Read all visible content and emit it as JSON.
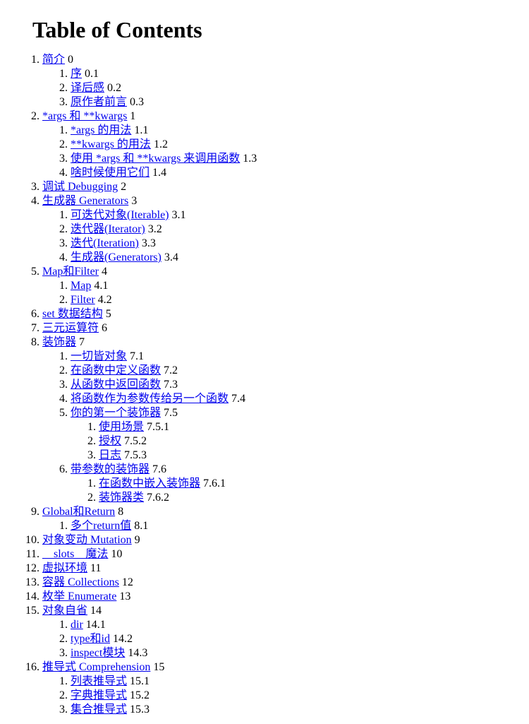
{
  "title": "Table of Contents",
  "toc": [
    {
      "label": "简介",
      "num": "0",
      "children": [
        {
          "label": "序",
          "num": "0.1"
        },
        {
          "label": "译后感",
          "num": "0.2"
        },
        {
          "label": "原作者前言",
          "num": "0.3"
        }
      ]
    },
    {
      "label": "*args 和 **kwargs",
      "num": "1",
      "children": [
        {
          "label": "*args 的用法",
          "num": "1.1"
        },
        {
          "label": "**kwargs 的用法",
          "num": "1.2"
        },
        {
          "label": "使用 *args 和 **kwargs 来调用函数",
          "num": "1.3"
        },
        {
          "label": "啥时候使用它们",
          "num": "1.4"
        }
      ]
    },
    {
      "label": "调试 Debugging",
      "num": "2"
    },
    {
      "label": "生成器 Generators",
      "num": "3",
      "children": [
        {
          "label": "可迭代对象(Iterable)",
          "num": "3.1"
        },
        {
          "label": "迭代器(Iterator)",
          "num": "3.2"
        },
        {
          "label": "迭代(Iteration)",
          "num": "3.3"
        },
        {
          "label": "生成器(Generators)",
          "num": "3.4"
        }
      ]
    },
    {
      "label": "Map和Filter",
      "num": "4",
      "children": [
        {
          "label": "Map",
          "num": "4.1"
        },
        {
          "label": "Filter",
          "num": "4.2"
        }
      ]
    },
    {
      "label": "set 数据结构",
      "num": "5"
    },
    {
      "label": "三元运算符",
      "num": "6"
    },
    {
      "label": "装饰器",
      "num": "7",
      "children": [
        {
          "label": "一切皆对象",
          "num": "7.1"
        },
        {
          "label": "在函数中定义函数",
          "num": "7.2"
        },
        {
          "label": "从函数中返回函数",
          "num": "7.3"
        },
        {
          "label": "将函数作为参数传给另一个函数",
          "num": "7.4"
        },
        {
          "label": "你的第一个装饰器",
          "num": "7.5",
          "children": [
            {
              "label": "使用场景",
              "num": "7.5.1"
            },
            {
              "label": "授权",
              "num": "7.5.2"
            },
            {
              "label": "日志",
              "num": "7.5.3"
            }
          ]
        },
        {
          "label": "带参数的装饰器",
          "num": "7.6",
          "children": [
            {
              "label": "在函数中嵌入装饰器",
              "num": "7.6.1"
            },
            {
              "label": "装饰器类",
              "num": "7.6.2"
            }
          ]
        }
      ]
    },
    {
      "label": "Global和Return",
      "num": "8",
      "children": [
        {
          "label": "多个return值",
          "num": "8.1"
        }
      ]
    },
    {
      "label": "对象变动 Mutation",
      "num": "9"
    },
    {
      "label": "__slots__魔法",
      "num": "10"
    },
    {
      "label": "虚拟环境",
      "num": "11"
    },
    {
      "label": "容器 Collections",
      "num": "12"
    },
    {
      "label": "枚举 Enumerate",
      "num": "13"
    },
    {
      "label": "对象自省",
      "num": "14",
      "children": [
        {
          "label": "dir",
          "num": "14.1"
        },
        {
          "label": "type和id",
          "num": "14.2"
        },
        {
          "label": "inspect模块",
          "num": "14.3"
        }
      ]
    },
    {
      "label": "推导式 Comprehension",
      "num": "15",
      "children": [
        {
          "label": "列表推导式",
          "num": "15.1"
        },
        {
          "label": "字典推导式",
          "num": "15.2"
        },
        {
          "label": "集合推导式",
          "num": "15.3"
        }
      ]
    }
  ]
}
